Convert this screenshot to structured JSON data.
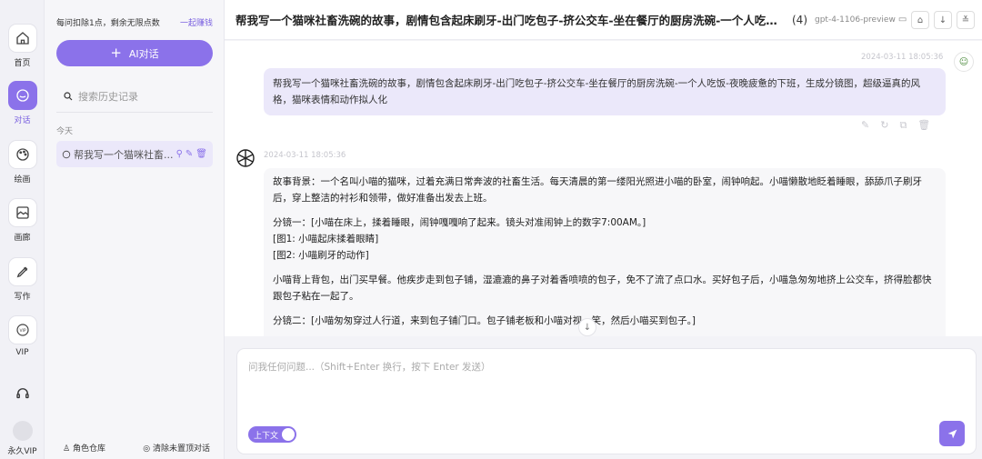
{
  "rail": {
    "items": [
      {
        "label": "首页",
        "icon": "home-icon"
      },
      {
        "label": "对话",
        "icon": "chat-icon",
        "active": true
      },
      {
        "label": "绘画",
        "icon": "palette-icon"
      },
      {
        "label": "画廊",
        "icon": "gallery-icon"
      },
      {
        "label": "写作",
        "icon": "pen-icon"
      },
      {
        "label": "VIP",
        "icon": "vip-icon"
      }
    ],
    "support_icon": "headset-icon",
    "user_label": "永久VIP"
  },
  "panel": {
    "quota_text": "每问扣除1点，剩余无限点数",
    "earn_link": "一起赚钱",
    "new_chat_label": "AI对话",
    "search_placeholder": "搜索历史记录",
    "group_label": "今天",
    "history_items": [
      {
        "title": "帮我写一个猫咪社畜..."
      }
    ],
    "footer_left": "角色仓库",
    "footer_right": "清除未置顶对话"
  },
  "header": {
    "title": "帮我写一个猫咪社畜洗碗的故事，剧情包含起床刷牙-出门吃包子-挤公交车-坐在餐厅的厨房洗碗-一个人吃饭-...",
    "count": "(4)",
    "model": "gpt-4-1106-preview"
  },
  "messages": {
    "user": {
      "timestamp": "2024-03-11 18:05:36",
      "text": "帮我写一个猫咪社畜洗碗的故事，剧情包含起床刷牙-出门吃包子-挤公交车-坐在餐厅的厨房洗碗-一个人吃饭-夜晚疲惫的下班，生成分镜图，超级逼真的风格，猫咪表情和动作拟人化"
    },
    "bot": {
      "timestamp": "2024-03-11 18:05:36",
      "paragraphs": [
        "故事背景：一个名叫小喵的猫咪，过着充满日常奔波的社畜生活。每天清晨的第一缕阳光照进小喵的卧室，闹钟响起。小喵懒散地眨着睡眼，舔舔爪子刷牙后，穿上整洁的衬衫和领带，做好准备出发去上班。",
        "分镜一：[小喵在床上，揉着睡眼，闹钟嘎嘎响了起来。镜头对准闹钟上的数字7:00AM。]\n[图1: 小喵起床揉着眼睛]\n[图2: 小喵刷牙的动作]",
        "小喵背上背包，出门买早餐。他疾步走到包子铺，湿漉漉的鼻子对着香喷喷的包子，免不了流了点口水。买好包子后，小喵急匆匆地挤上公交车，挤得脸都快跟包子粘在一起了。",
        "分镜二：[小喵匆匆穿过人行道，来到包子铺门口。包子铺老板和小喵对视一笑，然后小喵买到包子。]"
      ]
    }
  },
  "composer": {
    "placeholder": "问我任何问题...（Shift+Enter 换行，按下 Enter 发送）",
    "context_toggle_label": "上下文",
    "context_enabled": true
  },
  "colors": {
    "accent": "#8b72ea",
    "accent_light": "#ebe8fa"
  }
}
